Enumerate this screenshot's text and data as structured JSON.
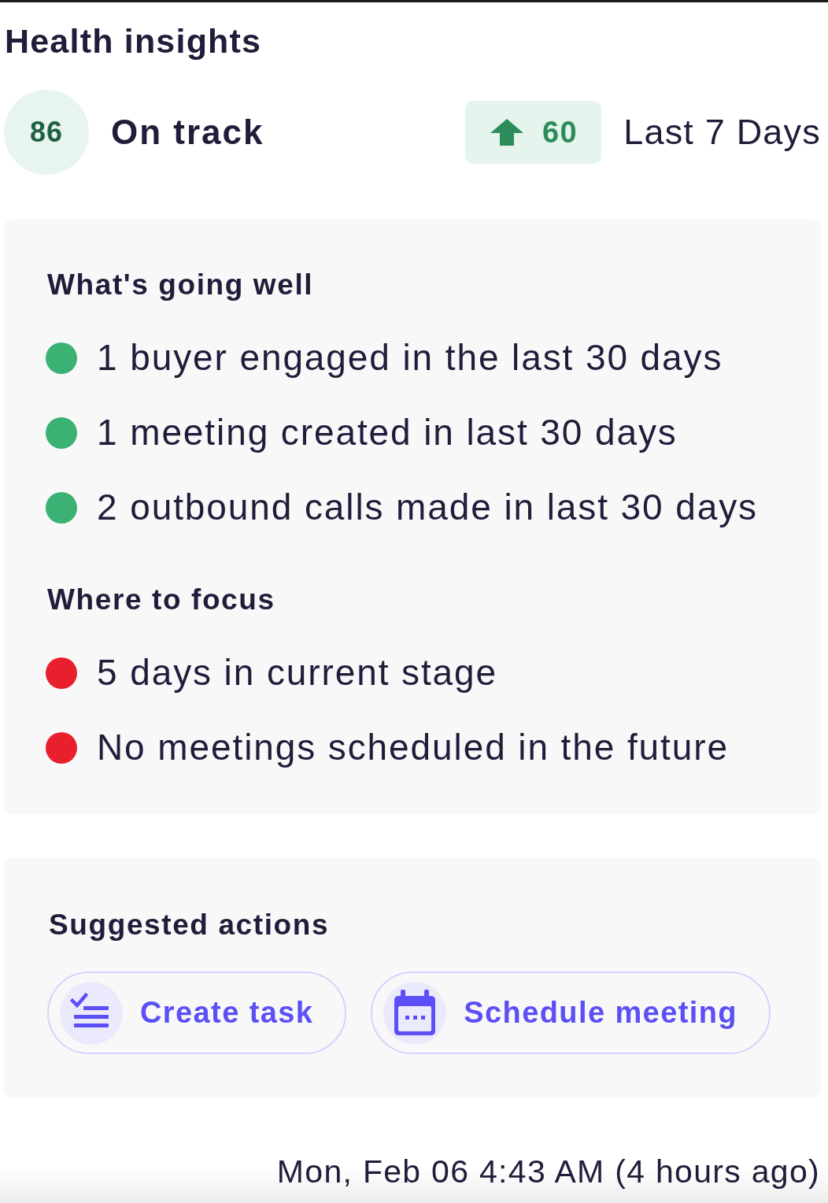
{
  "title": "Health insights",
  "score": {
    "value": "86",
    "label": "On track"
  },
  "trend": {
    "increase": true,
    "value": "60",
    "period": "Last 7 Days"
  },
  "sections": [
    {
      "heading": "What's going well",
      "items": [
        {
          "text": "1 buyer engaged in the last 30 days",
          "color": "#3bb273"
        },
        {
          "text": "1 meeting created in last 30 days",
          "color": "#3bb273"
        },
        {
          "text": "2 outbound calls made in last 30 days",
          "color": "#3bb273"
        }
      ]
    },
    {
      "heading": "Where to focus",
      "items": [
        {
          "text": "5 days in current stage",
          "color": "#e8202e"
        },
        {
          "text": "No meetings scheduled in the future",
          "color": "#e8202e"
        }
      ]
    }
  ],
  "actions": {
    "heading": "Suggested actions",
    "buttons": [
      {
        "kind": "task",
        "label": "Create task"
      },
      {
        "kind": "meeting",
        "label": "Schedule meeting"
      }
    ]
  },
  "updated": "Mon, Feb 06 4:43 AM (4 hours ago)"
}
